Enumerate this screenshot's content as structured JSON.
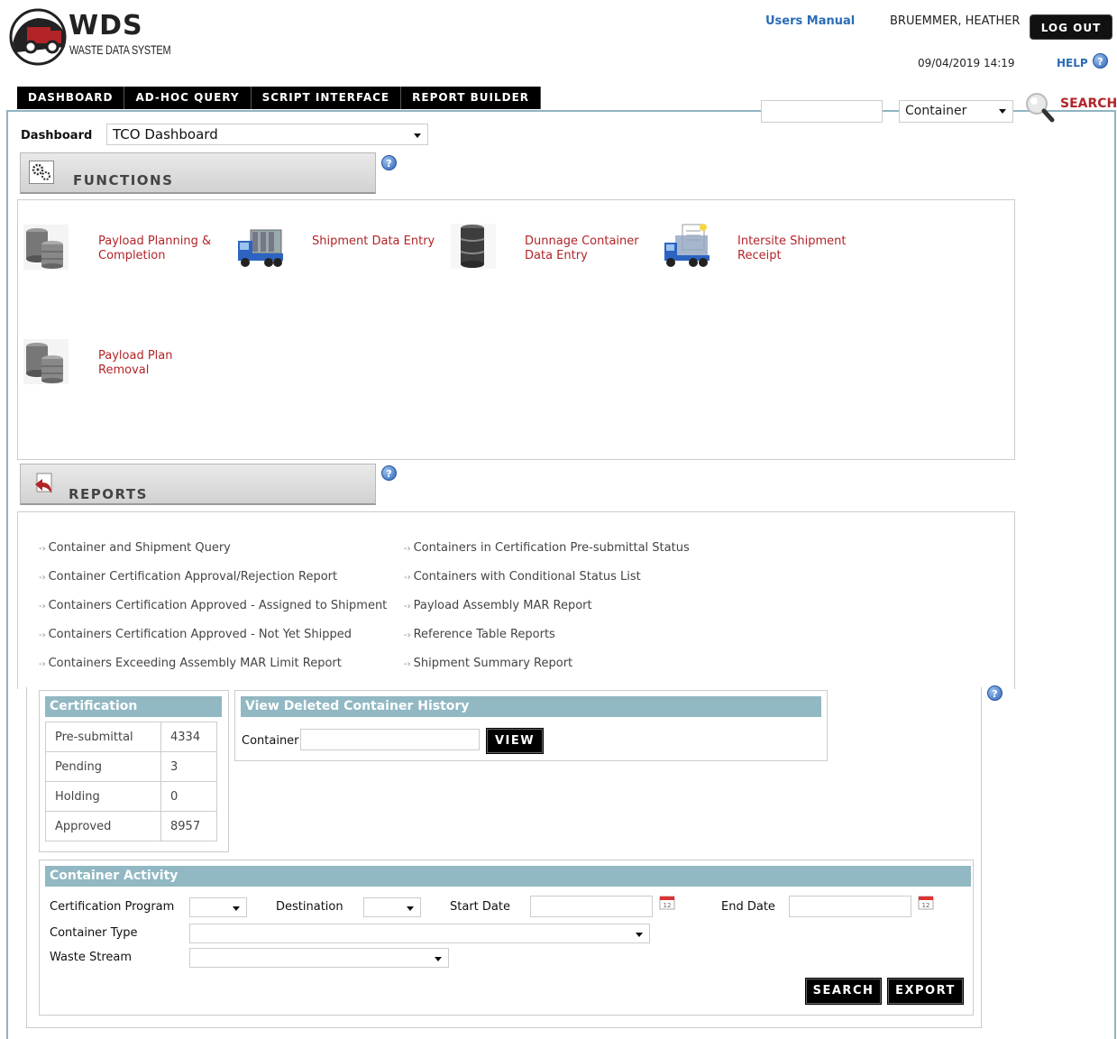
{
  "header": {
    "logo_big": "WDS",
    "logo_small": "WASTE DATA SYSTEM",
    "users_manual": "Users Manual",
    "username": "BRUEMMER, HEATHER",
    "logout": "LOG OUT",
    "datetime": "09/04/2019 14:19",
    "help": "HELP"
  },
  "nav": {
    "items": [
      "DASHBOARD",
      "AD-HOC QUERY",
      "SCRIPT INTERFACE",
      "REPORT BUILDER"
    ]
  },
  "search": {
    "input_value": "",
    "type_selected": "Container",
    "label": "SEARCH"
  },
  "dashboard": {
    "label": "Dashboard",
    "selected": "TCO Dashboard"
  },
  "functions": {
    "title": "FUNCTIONS",
    "items": [
      {
        "line1": "Payload Planning &",
        "line2": "Completion",
        "icon": "drums-icon"
      },
      {
        "line1": "Shipment Data Entry",
        "line2": "",
        "icon": "truck-icon"
      },
      {
        "line1": "Dunnage Container",
        "line2": "Data Entry",
        "icon": "barrel-icon"
      },
      {
        "line1": "Intersite Shipment",
        "line2": "Receipt",
        "icon": "truck-document-icon"
      },
      {
        "line1": "Payload Plan",
        "line2": "Removal",
        "icon": "drums-icon"
      }
    ]
  },
  "reports": {
    "title": "REPORTS",
    "left": [
      "Container and Shipment Query",
      "Container Certification Approval/Rejection Report",
      "Containers Certification Approved - Assigned to Shipment",
      "Containers Certification Approved - Not Yet Shipped",
      "Containers Exceeding Assembly MAR Limit Report"
    ],
    "right": [
      "Containers in Certification Pre-submittal Status",
      "Containers with Conditional Status List",
      "Payload Assembly MAR Report",
      "Reference Table Reports",
      "Shipment Summary Report"
    ]
  },
  "certification": {
    "title": "Certification",
    "rows": [
      {
        "label": "Pre-submittal",
        "value": "4334"
      },
      {
        "label": "Pending",
        "value": "3"
      },
      {
        "label": "Holding",
        "value": "0"
      },
      {
        "label": "Approved",
        "value": "8957"
      }
    ]
  },
  "deleted_history": {
    "title": "View Deleted Container History",
    "container_label": "Container",
    "container_value": "",
    "view_button": "VIEW"
  },
  "container_activity": {
    "title": "Container Activity",
    "cert_program_label": "Certification Program",
    "cert_program_value": "",
    "destination_label": "Destination",
    "destination_value": "",
    "start_date_label": "Start Date",
    "start_date_value": "",
    "end_date_label": "End Date",
    "end_date_value": "",
    "container_type_label": "Container Type",
    "container_type_value": "",
    "waste_stream_label": "Waste Stream",
    "waste_stream_value": "",
    "search_button": "SEARCH",
    "export_button": "EXPORT"
  },
  "colors": {
    "accent_red": "#b22428",
    "link_blue": "#2b6cb5",
    "widget_header": "#91b8c3",
    "frame_border": "#8fb4c0"
  }
}
